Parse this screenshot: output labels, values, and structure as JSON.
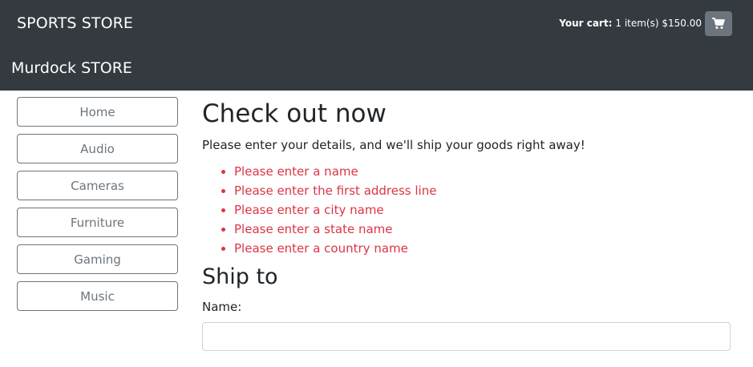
{
  "header": {
    "brand": "SPORTS STORE",
    "subbrand": "Murdock STORE",
    "cart_label": "Your cart:",
    "cart_summary": "1 item(s) $150.00",
    "cart_icon": "shopping-cart-icon",
    "background": "#343a40"
  },
  "sidebar": {
    "items": [
      {
        "label": "Home"
      },
      {
        "label": "Audio"
      },
      {
        "label": "Cameras"
      },
      {
        "label": "Furniture"
      },
      {
        "label": "Gaming"
      },
      {
        "label": "Music"
      }
    ]
  },
  "main": {
    "title": "Check out now",
    "intro": "Please enter your details, and we'll ship your goods right away!",
    "errors": [
      "Please enter a name",
      "Please enter the first address line",
      "Please enter a city name",
      "Please enter a state name",
      "Please enter a country name"
    ],
    "error_color": "#dc3545",
    "section_title": "Ship to",
    "name_label": "Name:",
    "name_value": ""
  }
}
